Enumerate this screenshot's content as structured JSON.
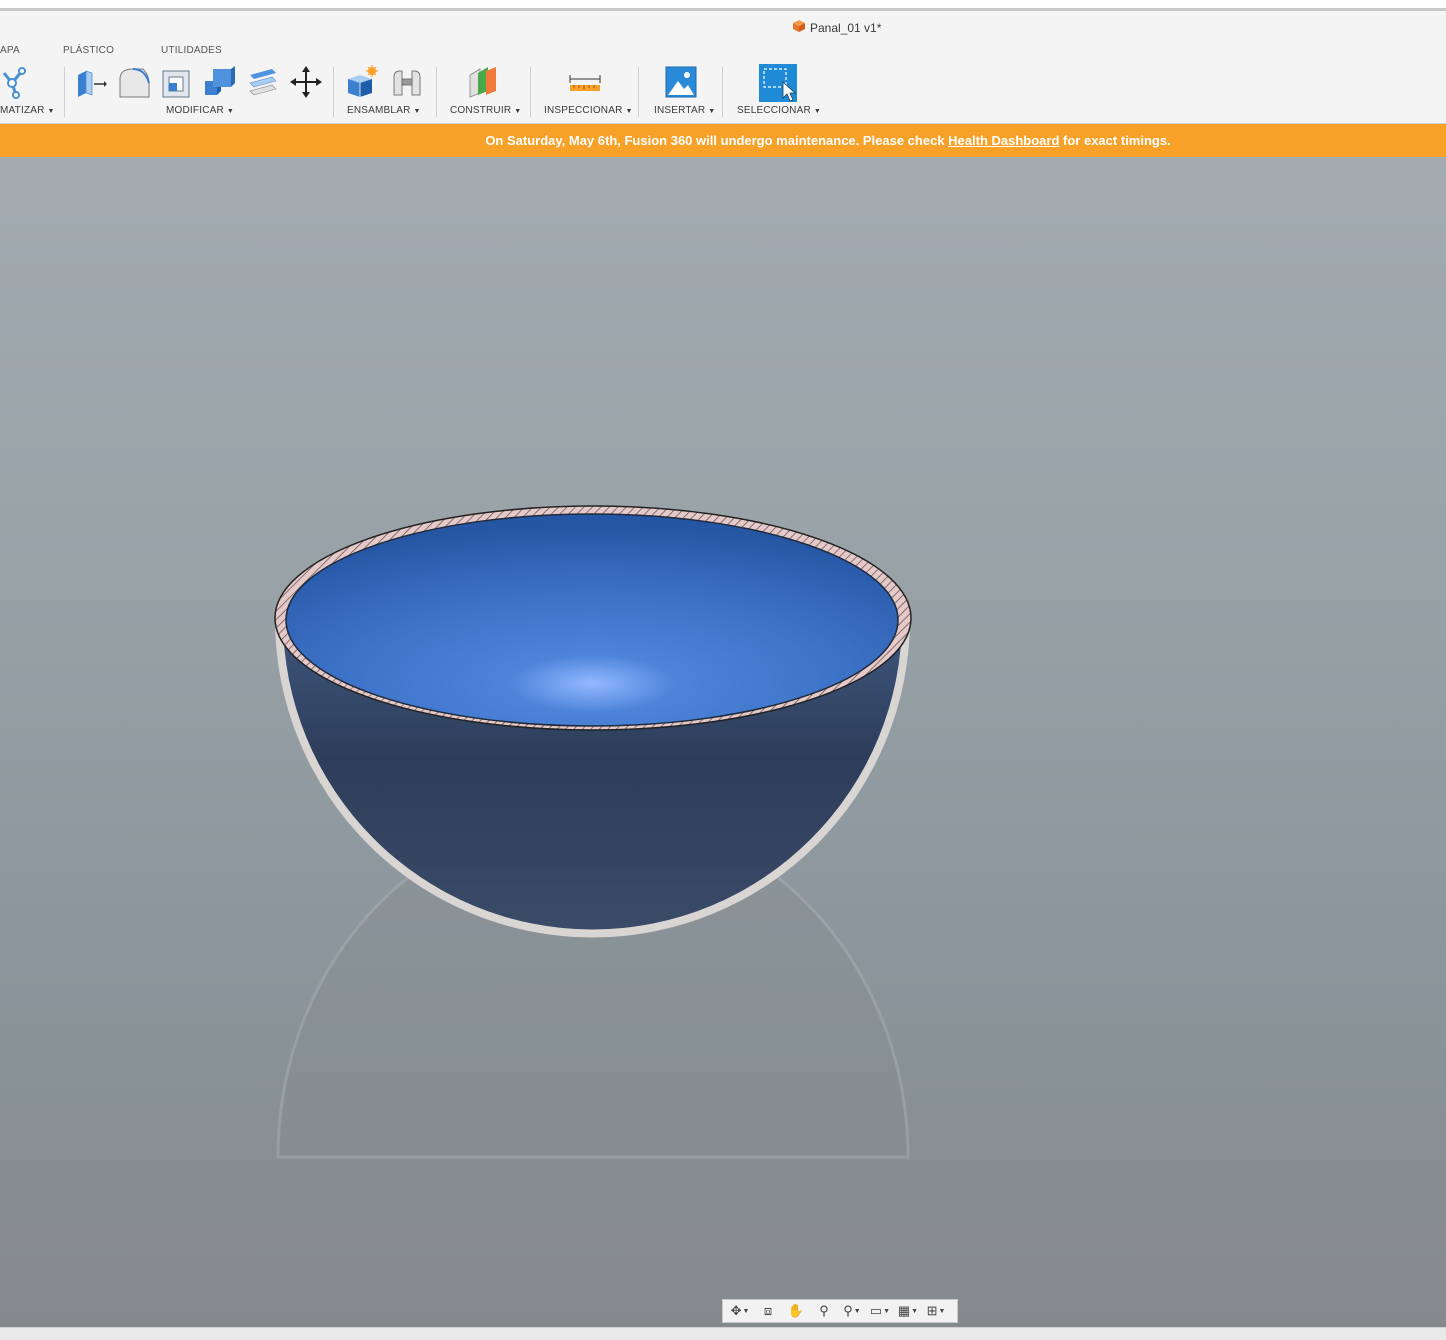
{
  "window": {
    "title": "Panal_01 v1*"
  },
  "toolbar": {
    "tabs": [
      "APA",
      "PLÁSTICO",
      "UTILIDADES"
    ],
    "groups": {
      "automatizar": "MATIZAR",
      "modificar": "MODIFICAR",
      "ensamblar": "ENSAMBLAR",
      "construir": "CONSTRUIR",
      "inspeccionar": "INSPECCIONAR",
      "insertar": "INSERTAR",
      "seleccionar": "SELECCIONAR"
    }
  },
  "banner": {
    "text_before": "On Saturday, May 6th, Fusion 360 will undergo maintenance. Please check ",
    "link": "Health Dashboard",
    "text_after": " for exact timings.",
    "color": "#f7a128"
  },
  "viewport": {
    "model": "bowl",
    "model_color": "#2e5fb0"
  },
  "navbar": {
    "icons": [
      "orbit-icon",
      "look-at-icon",
      "pan-icon",
      "zoom-icon",
      "zoom-window-icon",
      "display-settings-icon",
      "grid-icon",
      "viewports-icon"
    ]
  }
}
